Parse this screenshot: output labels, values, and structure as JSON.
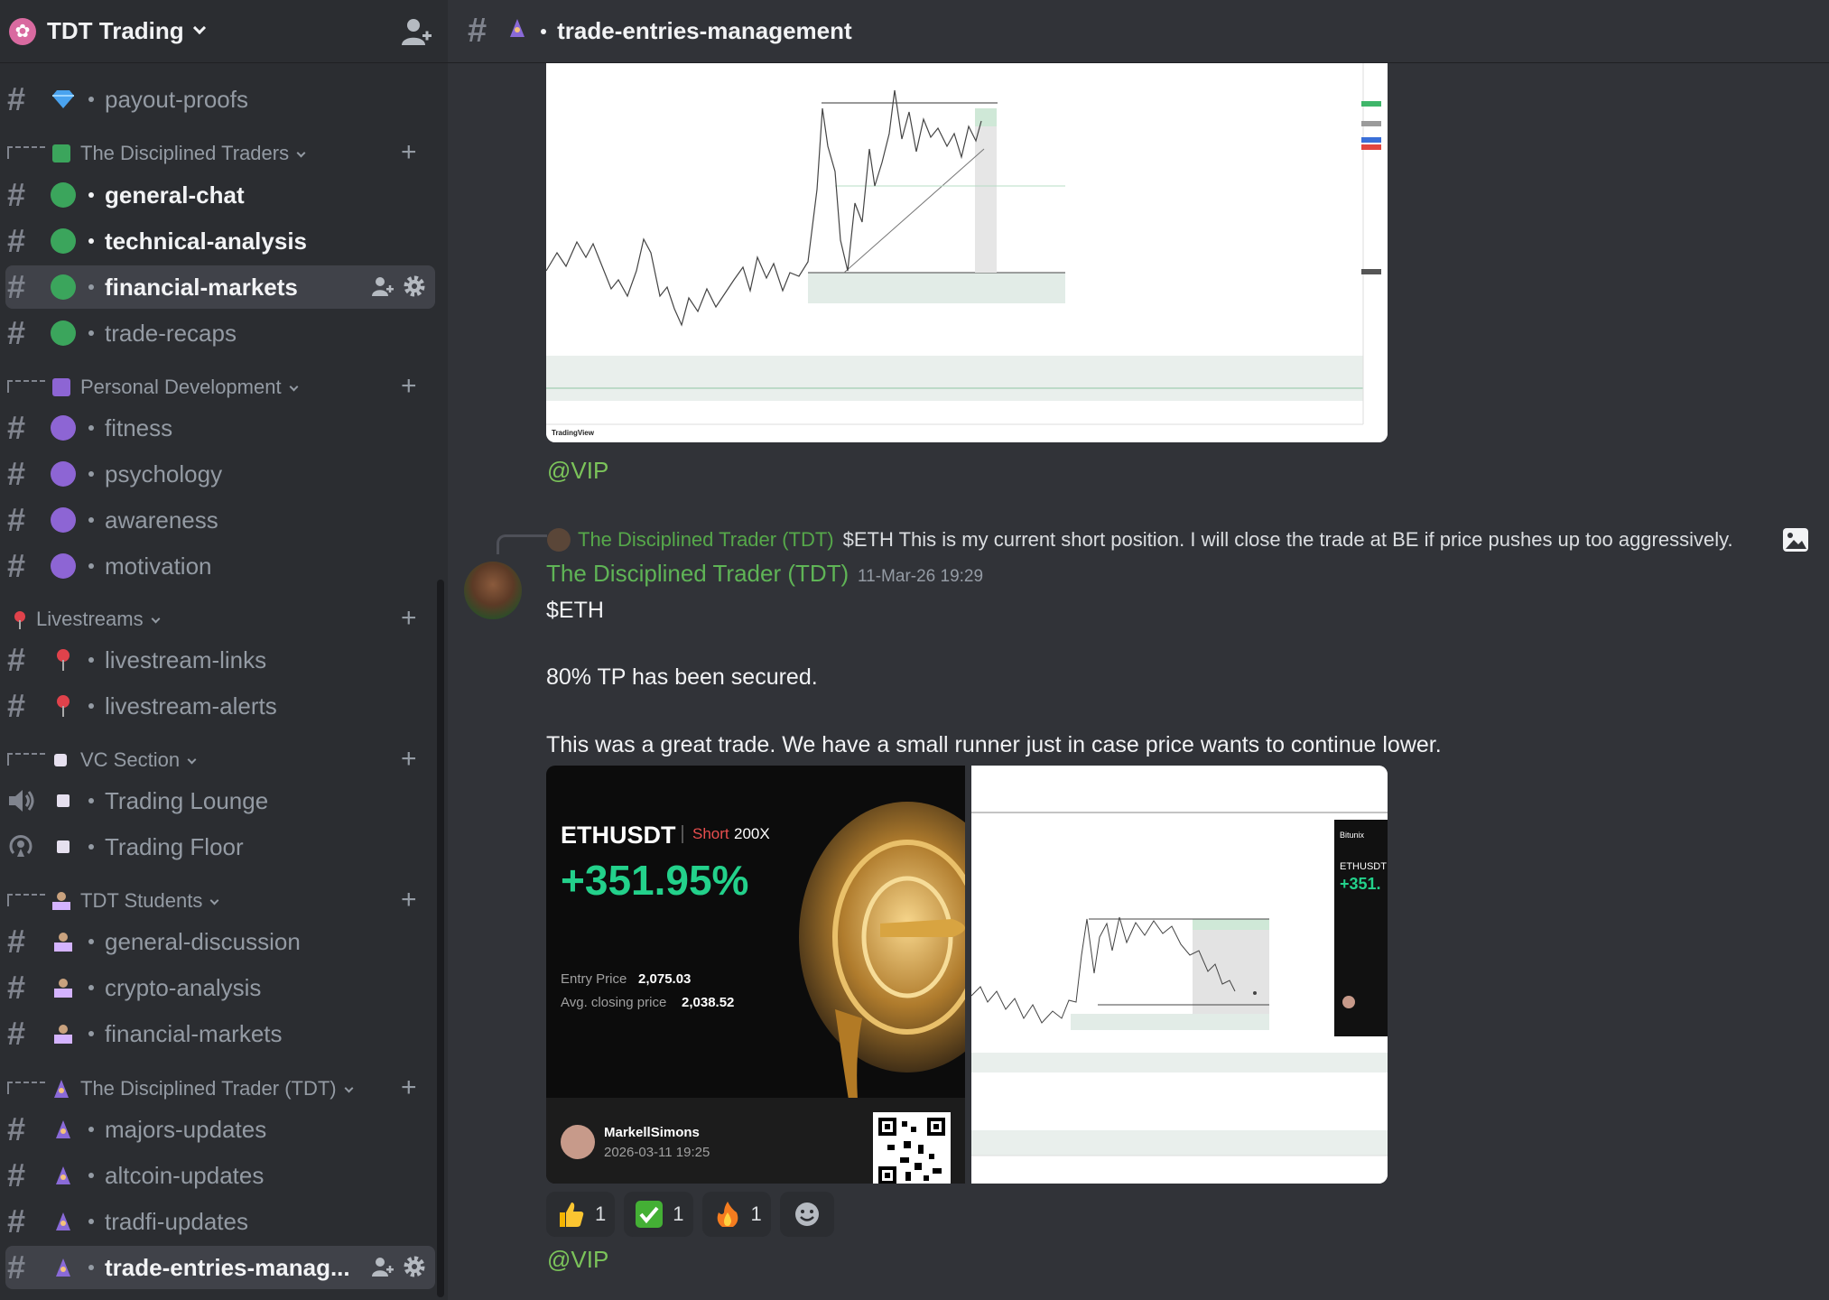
{
  "server": {
    "name": "TDT Trading"
  },
  "channel_top": {
    "label": "trade-entries-management"
  },
  "sidebar": {
    "channels_top": [
      {
        "label": "payout-proofs"
      }
    ],
    "categories": [
      {
        "label": "The Disciplined Traders",
        "color": "#3ba55c",
        "channels": [
          "general-chat",
          "technical-analysis",
          "financial-markets",
          "trade-recaps"
        ]
      },
      {
        "label": "Personal Development",
        "color": "#8d65d4",
        "channels": [
          "fitness",
          "psychology",
          "awareness",
          "motivation"
        ]
      },
      {
        "label": "Livestreams",
        "channels": [
          "livestream-links",
          "livestream-alerts"
        ]
      },
      {
        "label": "VC Section",
        "channels": [
          "Trading Lounge",
          "Trading Floor"
        ]
      },
      {
        "label": "TDT Students",
        "channels": [
          "general-discussion",
          "crypto-analysis",
          "financial-markets"
        ]
      },
      {
        "label": "The Disciplined Trader (TDT)",
        "channels": [
          "majors-updates",
          "altcoin-updates",
          "tradfi-updates",
          "trade-entries-manag..."
        ]
      }
    ]
  },
  "messages": {
    "prev_mention": "@VIP",
    "reply": {
      "author": "The Disciplined Trader (TDT)",
      "text": "$ETH  This is my current short position.  I will close the trade at BE if price pushes up too aggressively."
    },
    "author": "The Disciplined Trader (TDT)",
    "timestamp": "11-Mar-26 19:29",
    "lines": [
      "$ETH",
      "80% TP has been secured.",
      "This was a great trade. We have a small runner just in case price wants to continue lower."
    ],
    "card": {
      "pair": "ETHUSDT",
      "direction": "Short",
      "leverage": "200X",
      "pnl": "+351.95%",
      "entry_label": "Entry Price",
      "entry_value": "2,075.03",
      "close_label": "Avg. closing price",
      "close_value": "2,038.52",
      "username": "MarkellSimons",
      "date": "2026-03-11 19:25"
    },
    "chart2": {
      "mini_pair": "ETHUSDT",
      "mini_pnl": "+351.",
      "mini_brand": "Bitunix"
    },
    "chart1_brand": "TradingView",
    "reactions": [
      {
        "emoji": "thumbs-up",
        "count": "1"
      },
      {
        "emoji": "check",
        "count": "1"
      },
      {
        "emoji": "fire",
        "count": "1"
      }
    ],
    "mention": "@VIP"
  }
}
